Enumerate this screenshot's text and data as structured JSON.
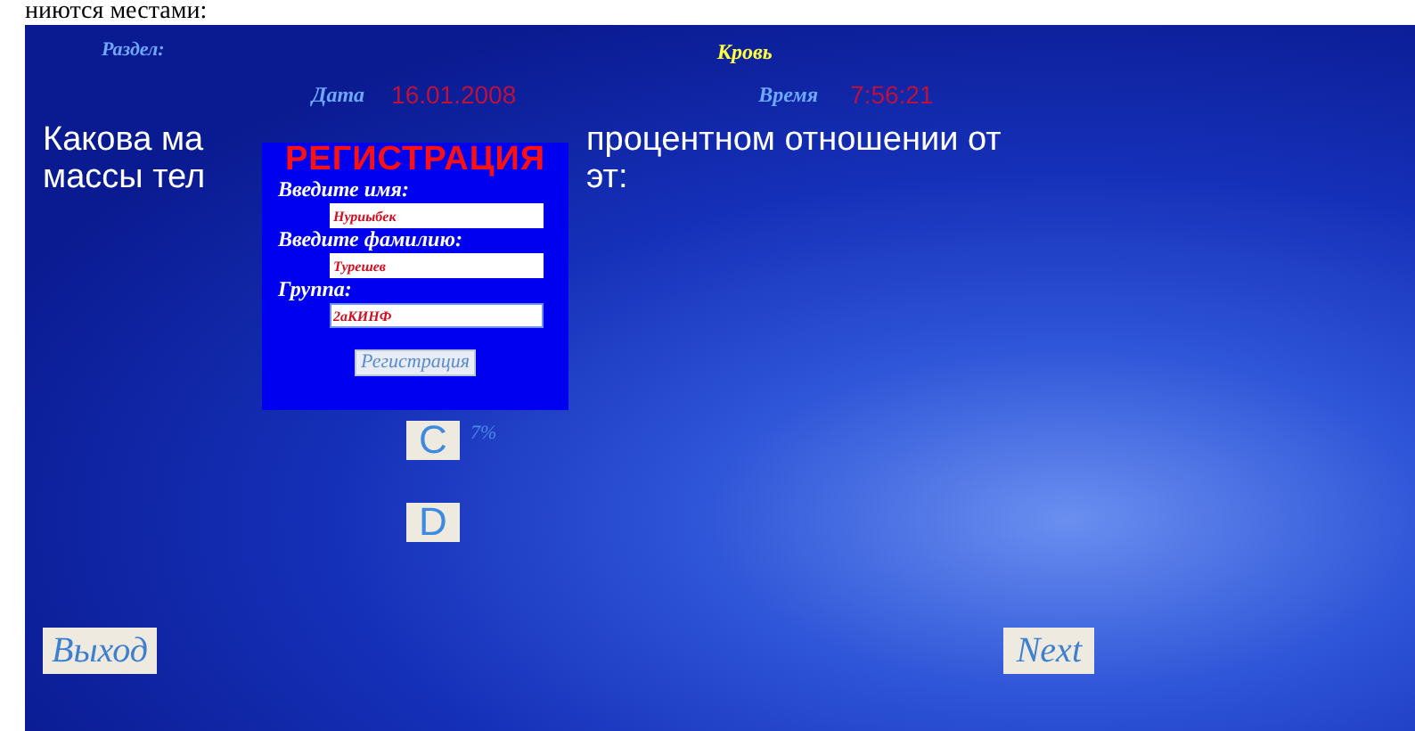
{
  "document_text": "ниются местами:",
  "header": {
    "section_label": "Раздел:",
    "section_value": "Кровь",
    "date_label": "Дата",
    "date_value": "16.01.2008",
    "time_label": "Время",
    "time_value": "7:56:21"
  },
  "question": {
    "line_1_left": "Какова ма",
    "line_1_right": "процентном отношении от",
    "line_2_left": "массы тел",
    "line_2_right": "эт:"
  },
  "answers": [
    {
      "letter": "C",
      "text": "7%"
    },
    {
      "letter": "D"
    }
  ],
  "dialog": {
    "title": "РЕГИСТРАЦИЯ",
    "fields": [
      {
        "label": "Введите имя:",
        "value": "Нуриыбек"
      },
      {
        "label": "Введите фамилию:",
        "value": "Турешев"
      },
      {
        "label": "Группа:",
        "value": "2аКИНФ",
        "focused": true
      }
    ],
    "button": "Регистрация"
  },
  "buttons": {
    "exit": "Выход",
    "next": "Next"
  }
}
